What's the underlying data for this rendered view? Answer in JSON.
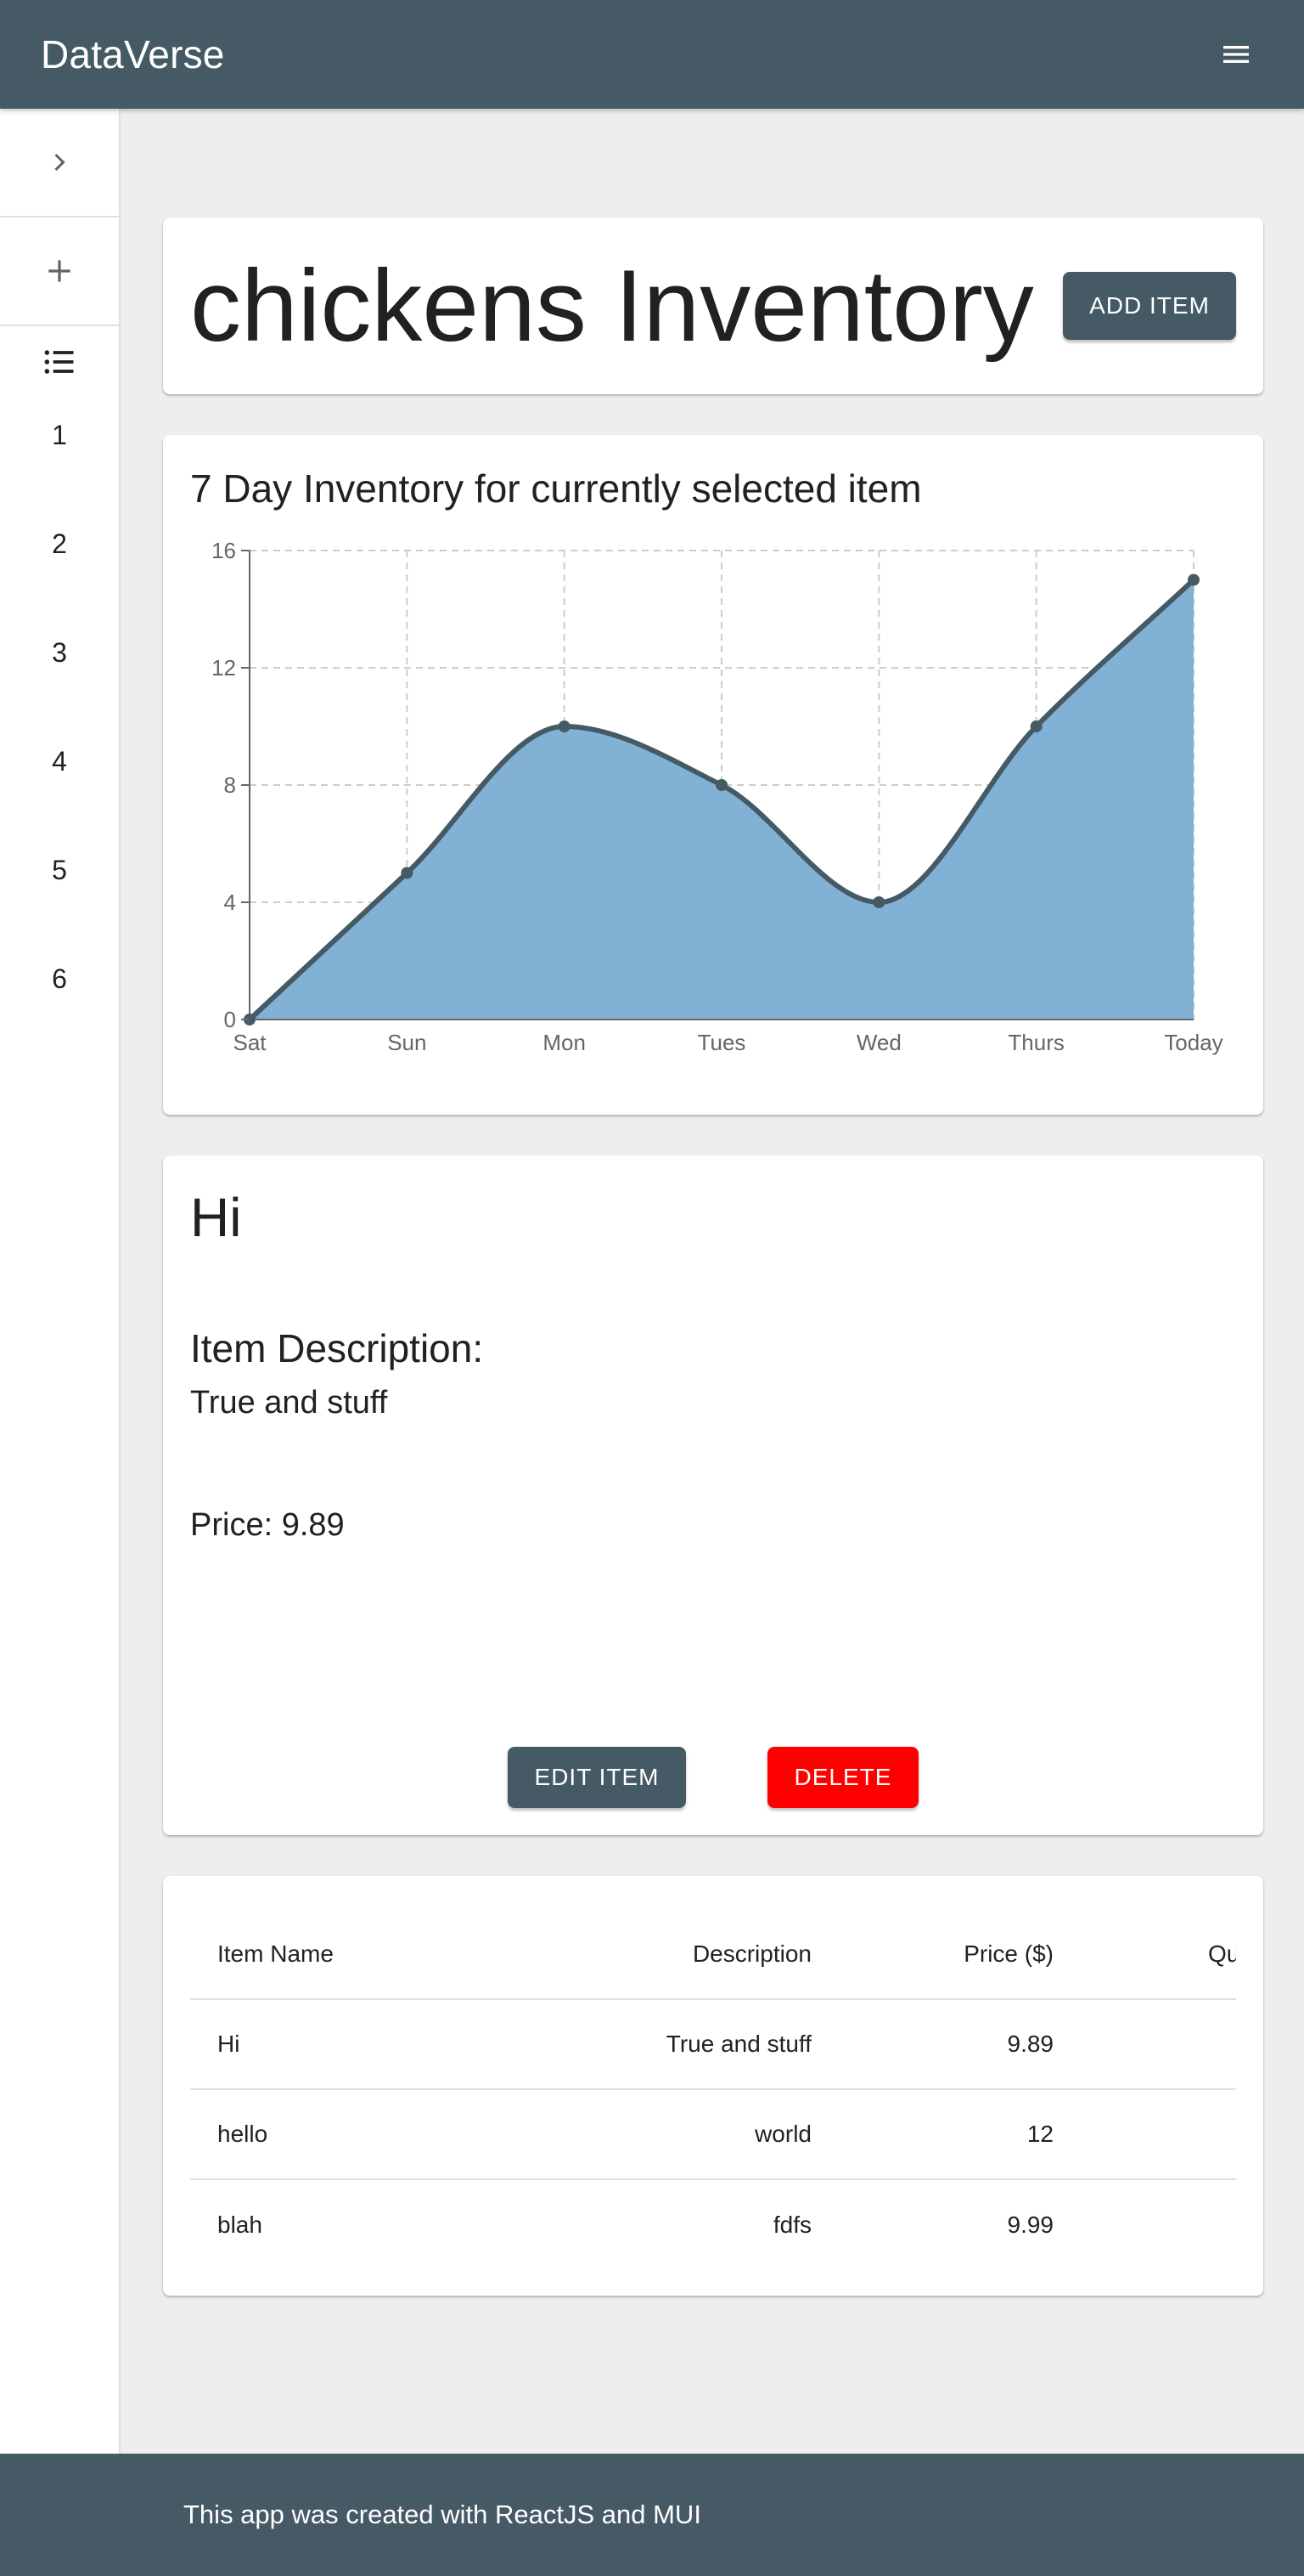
{
  "appbar": {
    "title": "DataVerse",
    "menu_icon": "hamburger-menu-icon"
  },
  "sidebar": {
    "expand_icon": "chevron-right-icon",
    "add_icon": "plus-icon",
    "list_icon": "list-icon",
    "items": [
      {
        "label": "1"
      },
      {
        "label": "2"
      },
      {
        "label": "3"
      },
      {
        "label": "4"
      },
      {
        "label": "5"
      },
      {
        "label": "6"
      }
    ]
  },
  "header": {
    "title": "chickens Inventory",
    "add_button": "ADD ITEM"
  },
  "chart_data": {
    "type": "area",
    "title": "7 Day Inventory for currently selected item",
    "categories": [
      "Sat",
      "Sun",
      "Mon",
      "Tues",
      "Wed",
      "Thurs",
      "Today"
    ],
    "values": [
      0,
      5,
      10,
      8,
      4,
      10,
      15
    ],
    "yticks": [
      0,
      4,
      8,
      12,
      16
    ],
    "ylim": [
      0,
      16
    ],
    "grid": true,
    "fill_color": "#82b1d6",
    "line_color": "#455a64"
  },
  "detail": {
    "name": "Hi",
    "description_heading": "Item Description:",
    "description": "True and stuff",
    "price": "Price: 9.89",
    "edit_button": "EDIT ITEM",
    "delete_button": "DELETE"
  },
  "table": {
    "columns": [
      "Item Name",
      "Description",
      "Price ($)",
      "Quan"
    ],
    "rows": [
      {
        "name": "Hi",
        "description": "True and stuff",
        "price": "9.89"
      },
      {
        "name": "hello",
        "description": "world",
        "price": "12"
      },
      {
        "name": "blah",
        "description": "fdfs",
        "price": "9.99"
      }
    ]
  },
  "footer": {
    "text": "This app was created with ReactJS and MUI"
  },
  "colors": {
    "primary": "#455a64",
    "danger": "#ff0000",
    "background": "#eeeeee"
  }
}
